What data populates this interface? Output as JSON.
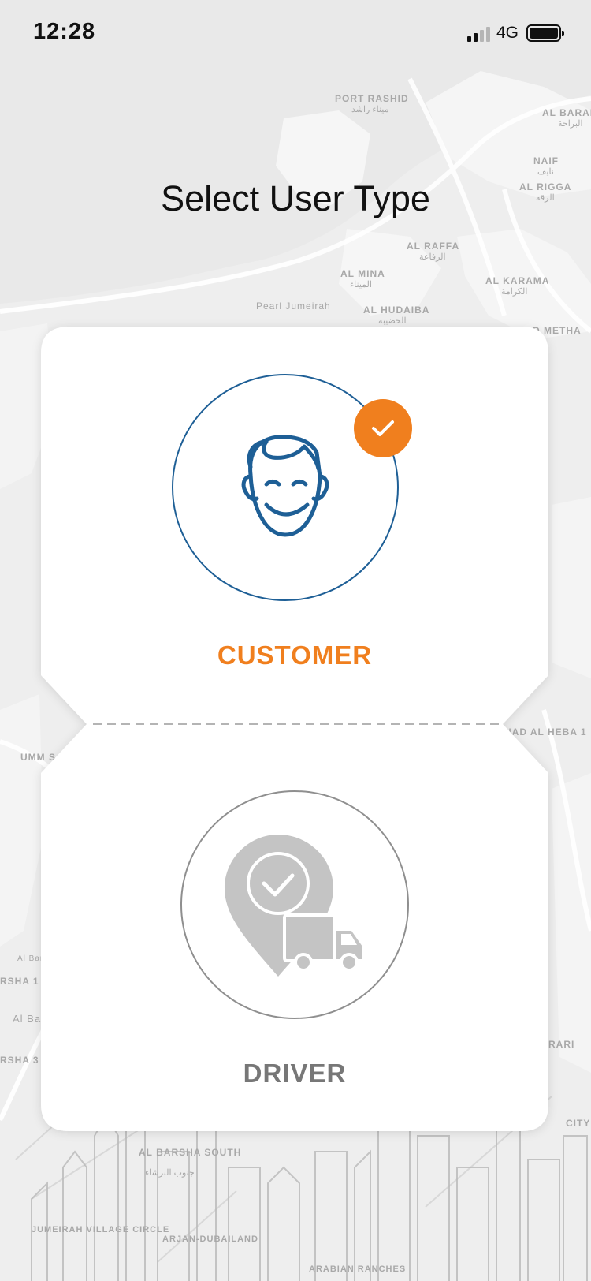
{
  "status_bar": {
    "time": "12:28",
    "network": "4G",
    "signal_icon": "signal-bars-icon",
    "battery_icon": "battery-full-icon"
  },
  "page": {
    "title": "Select User Type"
  },
  "map_labels": [
    {
      "en": "PORT RASHID",
      "ar": "ميناء راشد"
    },
    {
      "en": "AL BARAH",
      "ar": "البراحة"
    },
    {
      "en": "NAIF",
      "ar": "نايف"
    },
    {
      "en": "AL RIGGA",
      "ar": "الرقة"
    },
    {
      "en": "AL RAFFA",
      "ar": "الرفاعة"
    },
    {
      "en": "AL MINA",
      "ar": "الميناء"
    },
    {
      "en": "AL KARAMA",
      "ar": "الكرامة"
    },
    {
      "en": "Pearl Jumeirah",
      "ar": ""
    },
    {
      "en": "AL HUDAIBA",
      "ar": "الحضيبة"
    },
    {
      "en": "D METHA",
      "ar": ""
    },
    {
      "en": "AL BARSHA SOUTH",
      "ar": "جنوب البرشاء"
    },
    {
      "en": "JUMEIRAH VILLAGE CIRCLE",
      "ar": ""
    },
    {
      "en": "ARJAN-DUBAILAND",
      "ar": ""
    },
    {
      "en": "ARABIAN RANCHES",
      "ar": ""
    },
    {
      "en": "NAD AL HEBA 1",
      "ar": ""
    },
    {
      "en": "UMM S",
      "ar": ""
    },
    {
      "en": "RSHA 1",
      "ar": ""
    },
    {
      "en": "RSHA 3",
      "ar": ""
    },
    {
      "en": "RARI",
      "ar": ""
    },
    {
      "en": "CITY",
      "ar": ""
    },
    {
      "en": "Al Barsha Pond",
      "ar": ""
    },
    {
      "en": "Al Barsha",
      "ar": ""
    }
  ],
  "options": {
    "customer": {
      "label": "CUSTOMER",
      "selected": true,
      "icon": "customer-face-icon",
      "selected_icon": "check-icon",
      "color": "#f07f1e",
      "ring_color": "#1e5f96"
    },
    "driver": {
      "label": "DRIVER",
      "selected": false,
      "icon": "driver-truck-location-icon",
      "color": "#777777",
      "ring_color": "#8f8f8f"
    }
  }
}
